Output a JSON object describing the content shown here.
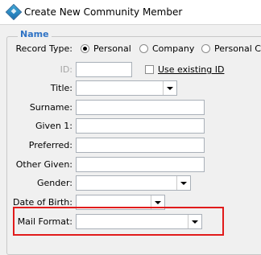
{
  "window": {
    "title": "Create New Community Member"
  },
  "group": {
    "legend": "Name"
  },
  "record_type": {
    "label": "Record Type:",
    "options": [
      "Personal",
      "Company",
      "Personal Co"
    ],
    "selected": "Personal"
  },
  "id_field": {
    "label": "ID:",
    "value": ""
  },
  "use_existing_id": {
    "label": "Use existing ID",
    "checked": false
  },
  "fields": {
    "title": {
      "label": "Title:",
      "value": ""
    },
    "surname": {
      "label": "Surname:",
      "value": ""
    },
    "given1": {
      "label": "Given 1:",
      "value": ""
    },
    "preferred": {
      "label": "Preferred:",
      "value": ""
    },
    "other_given": {
      "label": "Other Given:",
      "value": ""
    },
    "gender": {
      "label": "Gender:",
      "value": ""
    },
    "dob": {
      "label": "Date of Birth:",
      "value": ""
    },
    "mail_format": {
      "label": "Mail Format:",
      "value": ""
    }
  },
  "colors": {
    "legend": "#2f73c5",
    "highlight": "#e11b1b"
  }
}
